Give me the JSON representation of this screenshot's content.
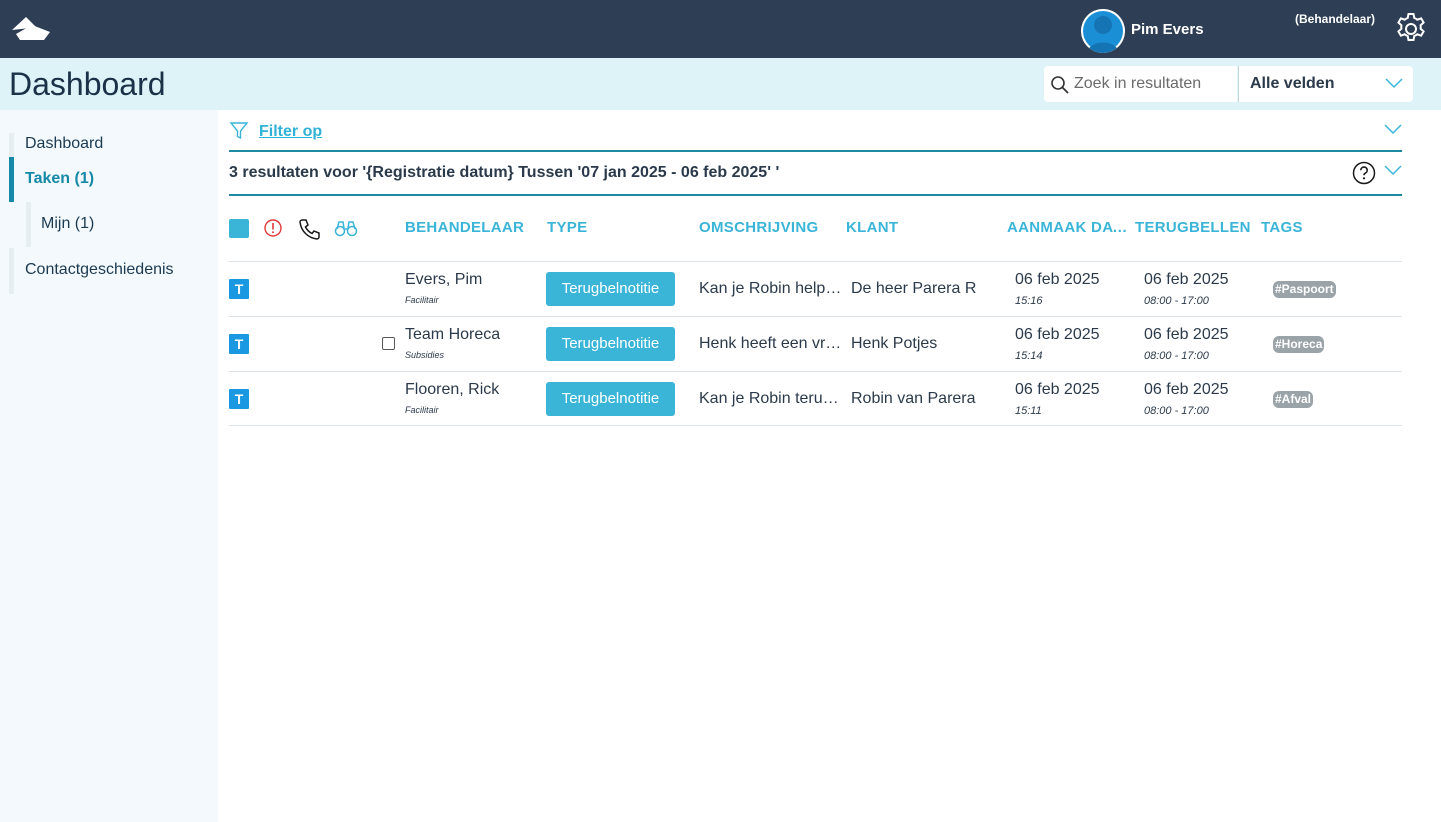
{
  "topbar": {
    "logo": "app-logo",
    "user_name": "Pim Evers",
    "role": "(Behandelaar)",
    "settings_icon": "gear-icon"
  },
  "header": {
    "title": "Dashboard",
    "search_placeholder": "Zoek in resultaten",
    "field_select": "Alle velden"
  },
  "sidebar": {
    "items": [
      {
        "label": "Dashboard"
      },
      {
        "label": "Taken (1)"
      },
      {
        "label": "Mijn (1)"
      },
      {
        "label": "Contactgeschiedenis"
      }
    ]
  },
  "filter": {
    "label": "Filter op"
  },
  "results": {
    "text": "3 resultaten voor '{Registratie datum} Tussen '07 jan 2025 - 06 feb 2025' '"
  },
  "columns": {
    "behandelaar": "BEHANDELAAR",
    "type": "TYPE",
    "omschrijving": "OMSCHRIJVING",
    "klant": "KLANT",
    "aanmaak": "AANMAAK DATUM",
    "terugbellen": "TERUGBELLEN",
    "tags": "TAGS"
  },
  "rows": [
    {
      "badge": "T",
      "name": "Evers, Pim",
      "department": "Facilitair",
      "type": "Terugbelnotitie",
      "description": "Kan je Robin helpen met zijn paspoort",
      "client": "De heer Parera R",
      "created_date": "06 feb 2025",
      "created_time": "15:16",
      "callback_date": "06 feb 2025",
      "callback_time": "08:00 - 17:00",
      "tag": "#Paspoort"
    },
    {
      "badge": "T",
      "name": "Team Horeca",
      "department": "Subsidies",
      "type": "Terugbelnotitie",
      "description": "Henk heeft een vraag over horeca",
      "client": "Henk Potjes",
      "created_date": "06 feb 2025",
      "created_time": "15:14",
      "callback_date": "06 feb 2025",
      "callback_time": "08:00 - 17:00",
      "tag": "#Horeca"
    },
    {
      "badge": "T",
      "name": "Flooren, Rick",
      "department": "Facilitair",
      "type": "Terugbelnotitie",
      "description": "Kan je Robin terugbellen over afval",
      "client": "Robin van Parera",
      "created_date": "06 feb 2025",
      "created_time": "15:11",
      "callback_date": "06 feb 2025",
      "callback_time": "08:00 - 17:00",
      "tag": "#Afval"
    }
  ],
  "colors": {
    "topbar": "#2d3e55",
    "header": "#ddf3f7",
    "accent": "#3ab5d8",
    "active_nav": "#1589a8",
    "badge": "#1a98e1",
    "tag": "#9aa3a8"
  }
}
